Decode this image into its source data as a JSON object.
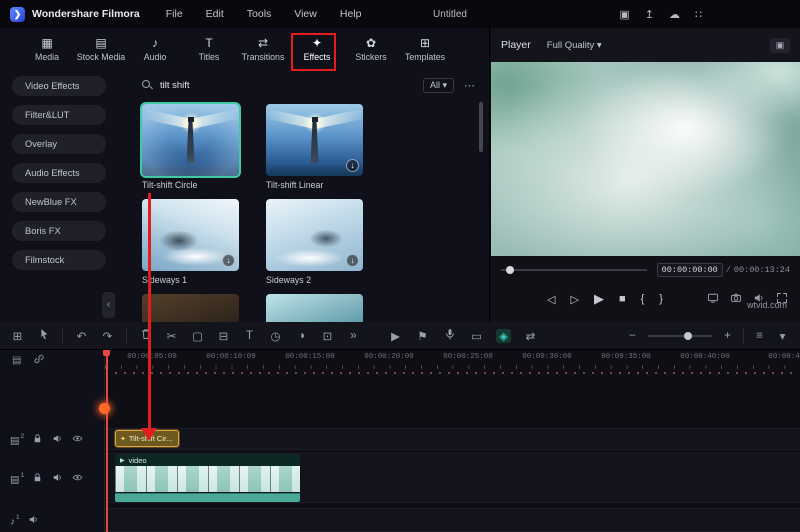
{
  "titlebar": {
    "app_name": "Wondershare Filmora",
    "menus": [
      {
        "label": "File"
      },
      {
        "label": "Edit"
      },
      {
        "label": "Tools"
      },
      {
        "label": "View"
      },
      {
        "label": "Help"
      }
    ],
    "project_title": "Untitled"
  },
  "icons": {
    "logo": "❯",
    "layout": "▣",
    "export": "↥",
    "cloud": "☁",
    "apps": "∷",
    "media_tab": "▦",
    "stock_tab": "▤",
    "audio_tab": "♪",
    "titles_tab": "T",
    "transitions_tab": "⇄",
    "effects_tab": "✦",
    "stickers_tab": "✿",
    "templates_tab": "⊞",
    "dropdown": "▾",
    "dots_menu": "⋯",
    "collapse": "‹",
    "download": "↓",
    "workspace": "⊞",
    "undo": "↶",
    "redo": "↷",
    "scissors": "✂",
    "crop": "▢",
    "split": "⊟",
    "text_tool": "T",
    "speed": "◷",
    "color": "◑",
    "chroma": "⊡",
    "more": "»",
    "render": "▶",
    "marker": "⚑",
    "record": "▭",
    "keyframe": "◈",
    "transition_tool": "⇄",
    "zoom_out": "−",
    "zoom_in": "+",
    "rows": "≡",
    "music": "♪",
    "prev_frame": "◁",
    "step_play": "▷",
    "play": "▶",
    "stop": "■",
    "mark_in": "{",
    "mark_out": "}",
    "player_panel": "▣",
    "manage_tracks": "▤",
    "media_track": "▤",
    "clip_fx": "✦",
    "clip_play": "▶"
  },
  "tabbar": {
    "tabs": [
      {
        "label": "Media"
      },
      {
        "label": "Stock Media"
      },
      {
        "label": "Audio"
      },
      {
        "label": "Titles"
      },
      {
        "label": "Transitions"
      },
      {
        "label": "Effects"
      },
      {
        "label": "Stickers"
      },
      {
        "label": "Templates"
      }
    ]
  },
  "sidebar": {
    "items": [
      {
        "label": "Video Effects"
      },
      {
        "label": "Filter&LUT"
      },
      {
        "label": "Overlay"
      },
      {
        "label": "Audio Effects"
      },
      {
        "label": "NewBlue FX"
      },
      {
        "label": "Boris FX"
      },
      {
        "label": "Filmstock"
      }
    ]
  },
  "library": {
    "search_value": "tilt shift",
    "filter_label": "All",
    "effects": [
      {
        "name": "Tilt-shift Circle",
        "selected": true
      },
      {
        "name": "Tilt-shift Linear",
        "selected": false
      },
      {
        "name": "Sideways 1",
        "selected": false
      },
      {
        "name": "Sideways 2",
        "selected": false
      }
    ]
  },
  "player": {
    "label": "Player",
    "quality": "Full Quality",
    "current_time": "00:00:00:00",
    "time_separator": "/",
    "duration": "00:00:13:24"
  },
  "timeline": {
    "ruler_labels": [
      "00:00:05:00",
      "00:00:10:00",
      "00:00:15:00",
      "00:00:20:00",
      "00:00:25:00",
      "00:00:30:00",
      "00:00:35:00",
      "00:00:40:00",
      "00:00:4"
    ],
    "tracks": [
      {
        "badge": "2",
        "clip_label": "Tilt-shift Cir..."
      },
      {
        "badge": "1",
        "clip_label": "video"
      },
      {
        "badge": "1",
        "clip_label": ""
      }
    ]
  },
  "watermark": "wtvid.com"
}
